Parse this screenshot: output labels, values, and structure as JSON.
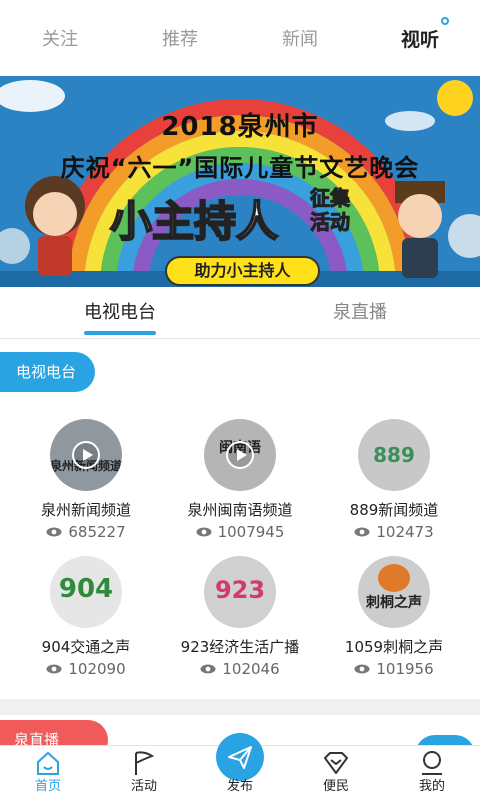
{
  "top_tabs": [
    {
      "label": "关注",
      "active": false
    },
    {
      "label": "推荐",
      "active": false
    },
    {
      "label": "新闻",
      "active": false
    },
    {
      "label": "视听",
      "active": true
    }
  ],
  "banner": {
    "line1": "2018泉州市",
    "line2": "庆祝“六一”国际儿童节文艺晚会",
    "line3": "小主持人",
    "line4a": "征集",
    "line4b": "活动",
    "button": "助力小主持人"
  },
  "sub_tabs": [
    {
      "label": "电视电台",
      "active": true
    },
    {
      "label": "泉直播",
      "active": false
    }
  ],
  "section_title": "电视电台",
  "channels": [
    {
      "name": "泉州新闻频道",
      "views": "685227",
      "logo_text": "泉州新闻频道",
      "color": "#9aa3a8"
    },
    {
      "name": "泉州闽南语频道",
      "views": "1007945",
      "logo_text": "闽南语",
      "color": "#b8b8b8"
    },
    {
      "name": "889新闻频道",
      "views": "102473",
      "logo_text": "889",
      "color": "#c9c9c9"
    },
    {
      "name": "904交通之声",
      "views": "102090",
      "logo_text": "904",
      "color": "#e4e4e4"
    },
    {
      "name": "923经济生活广播",
      "views": "102046",
      "logo_text": "923",
      "color": "#d2d2d2"
    },
    {
      "name": "1059刺桐之声",
      "views": "101956",
      "logo_text": "刺桐之声",
      "color": "#cfcfcf"
    }
  ],
  "next_section_title": "泉直播",
  "bottom_nav": [
    {
      "label": "首页",
      "icon": "home-icon",
      "active": true
    },
    {
      "label": "活动",
      "icon": "flag-icon",
      "active": false
    },
    {
      "label": "发布",
      "icon": "send-icon",
      "active": false
    },
    {
      "label": "便民",
      "icon": "diamond-icon",
      "active": false
    },
    {
      "label": "我的",
      "icon": "user-icon",
      "active": false
    }
  ],
  "colors": {
    "accent": "#2aa3e3",
    "live": "#f05a5a",
    "banner_yellow": "#ffe11a"
  }
}
